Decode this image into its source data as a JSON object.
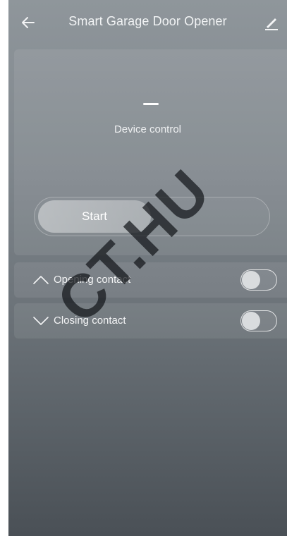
{
  "header": {
    "title": "Smart Garage Door Opener",
    "back_icon": "arrow-left-icon",
    "edit_icon": "pencil-icon"
  },
  "control": {
    "status_dash": "—",
    "label": "Device control",
    "start_label": "Start"
  },
  "contacts": [
    {
      "label": "Opening contact",
      "icon": "chevron-up-icon",
      "enabled": false
    },
    {
      "label": "Closing contact",
      "icon": "chevron-down-icon",
      "enabled": false
    }
  ],
  "watermark": {
    "text": "CT.HU"
  }
}
